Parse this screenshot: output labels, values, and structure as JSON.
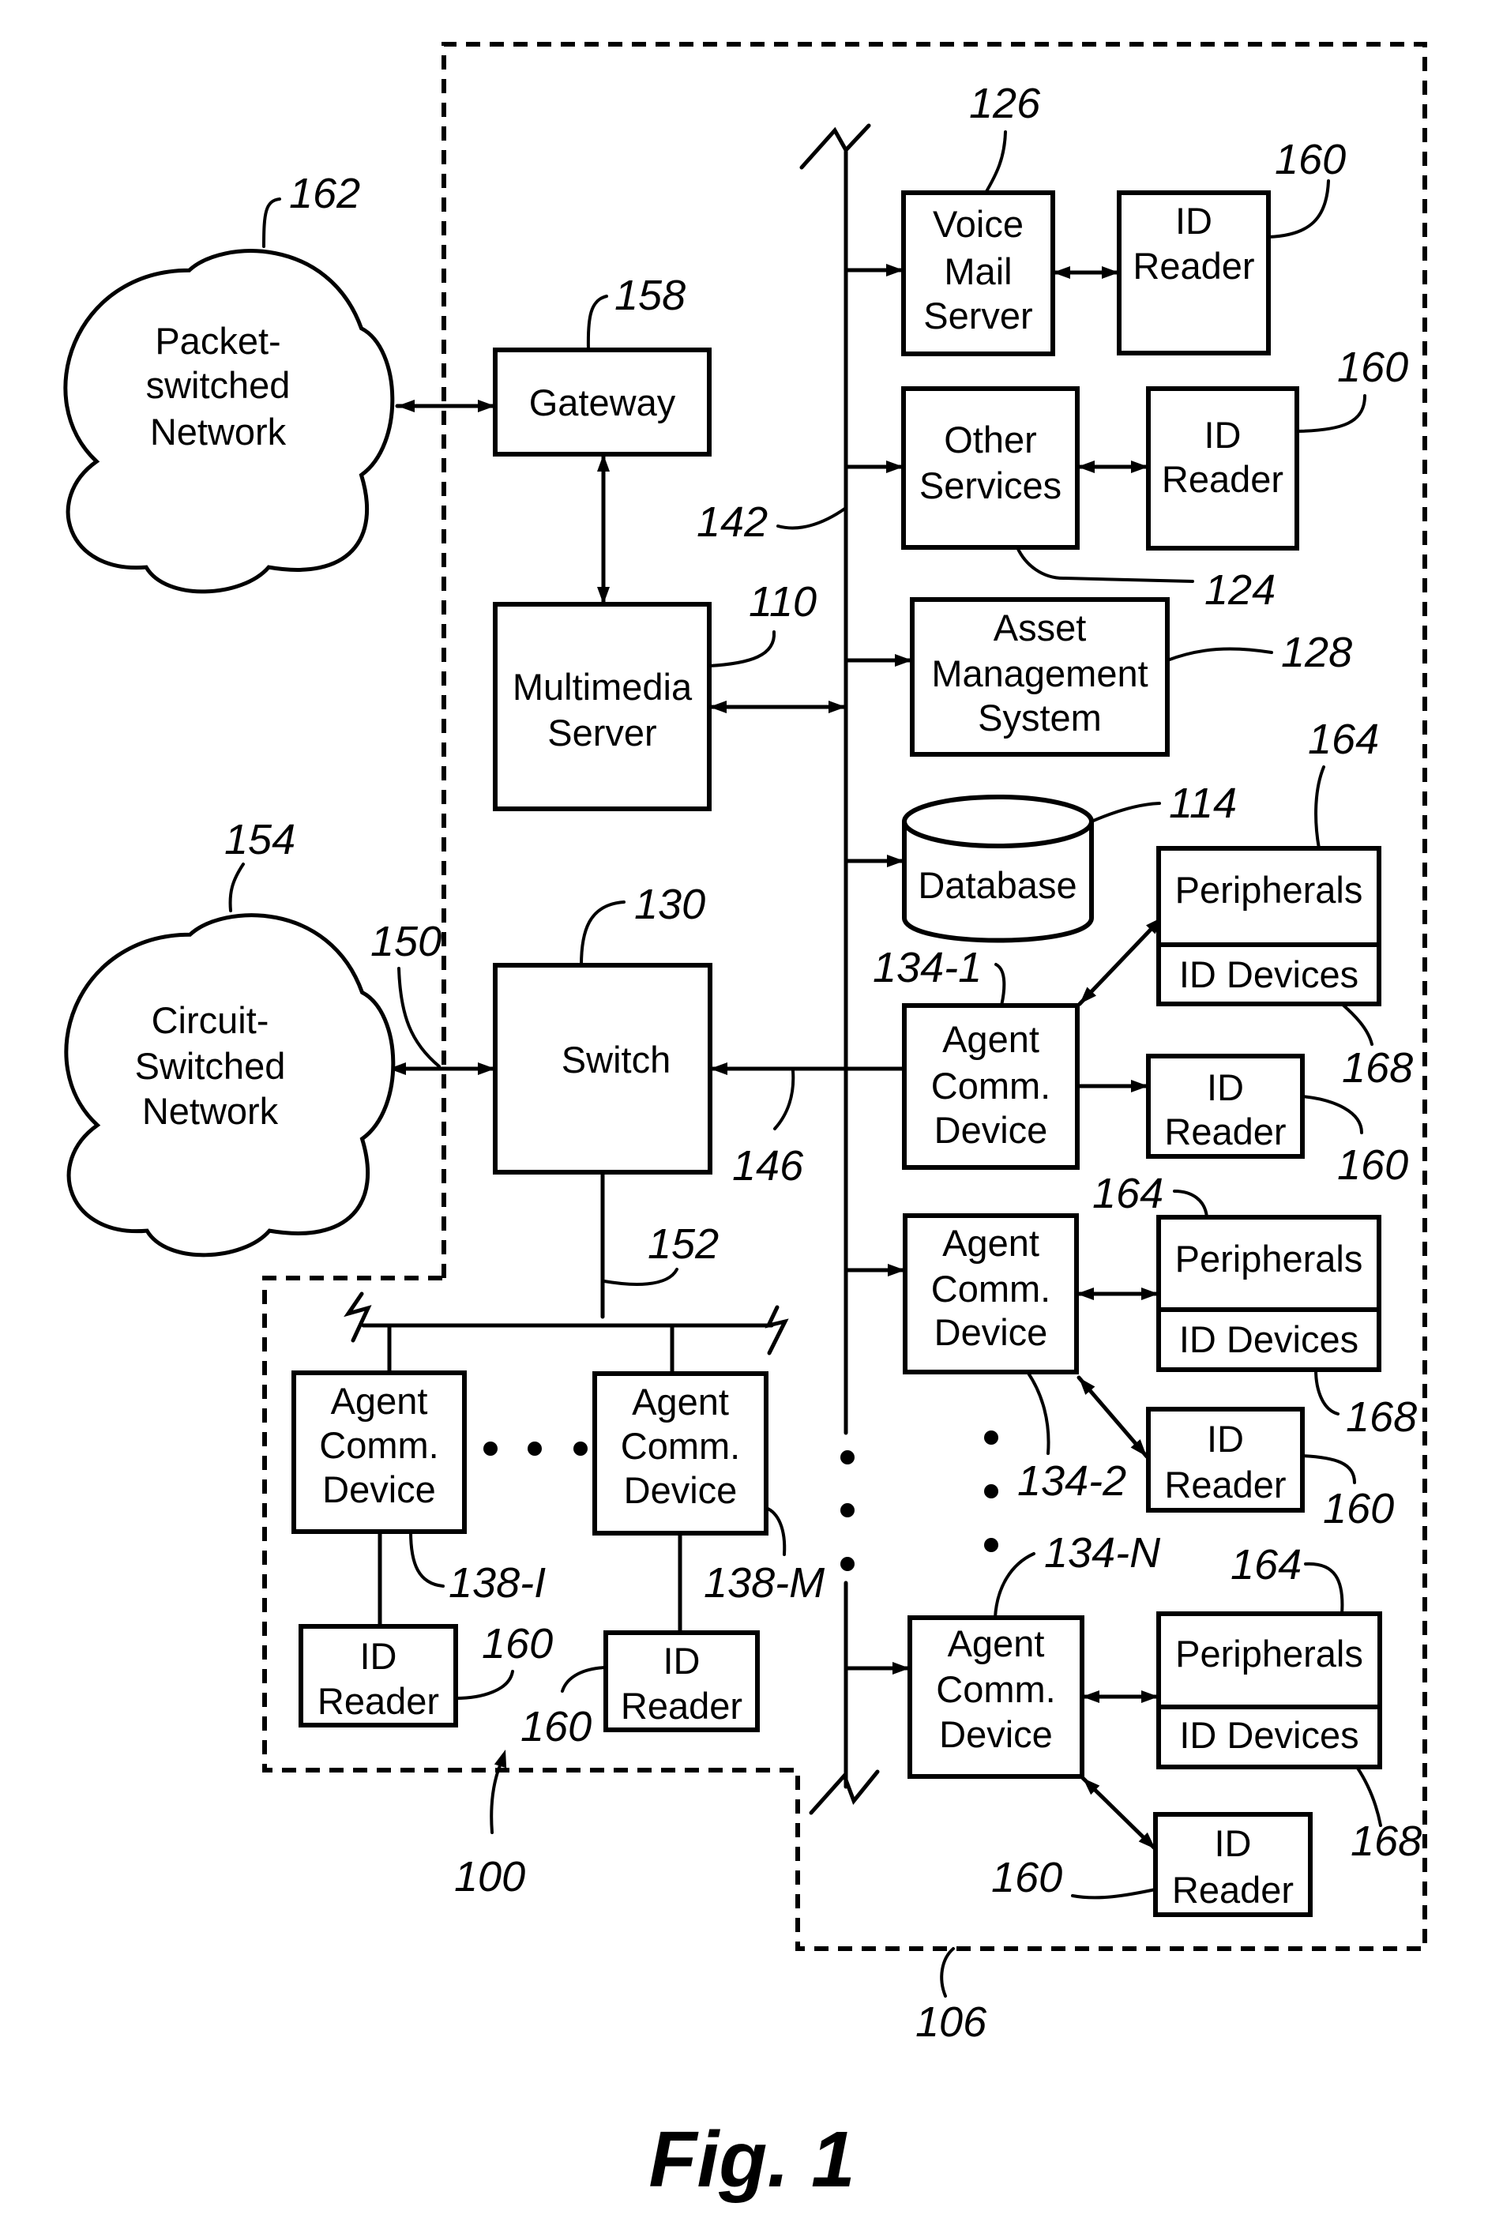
{
  "figure": {
    "caption": "Fig. 1",
    "colors": {
      "ink": "#000000",
      "paper": "#ffffff"
    }
  },
  "clouds": {
    "packet": {
      "ref": "162",
      "lines": [
        "Packet-",
        "switched",
        "Network"
      ]
    },
    "circuit": {
      "ref": "154",
      "lines": [
        "Circuit-",
        "Switched",
        "Network"
      ]
    }
  },
  "boxes": {
    "gateway": {
      "ref": "158",
      "lines": [
        "Gateway"
      ]
    },
    "multimedia_server": {
      "ref": "110",
      "lines": [
        "Multimedia",
        "Server"
      ]
    },
    "switch": {
      "ref": "130",
      "lines": [
        "Switch"
      ]
    },
    "voice_mail_server": {
      "ref": "126",
      "lines": [
        "Voice",
        "Mail",
        "Server"
      ]
    },
    "id_reader_voice_mail": {
      "ref": "160",
      "lines": [
        "ID",
        "Reader"
      ]
    },
    "other_services": {
      "ref": "124",
      "lines": [
        "Other",
        "Services"
      ]
    },
    "id_reader_other_services": {
      "ref": "160",
      "lines": [
        "ID",
        "Reader"
      ]
    },
    "asset_management": {
      "ref": "128",
      "lines": [
        "Asset",
        "Management",
        "System"
      ]
    },
    "database": {
      "ref": "114",
      "lines": [
        "Database"
      ]
    },
    "agent_134_1": {
      "ref": "134-1",
      "lines": [
        "Agent",
        "Comm.",
        "Device"
      ]
    },
    "peripherals_1": {
      "ref": "164",
      "lines": [
        "Peripherals"
      ]
    },
    "id_devices_1": {
      "ref": "168",
      "lines": [
        "ID Devices"
      ]
    },
    "id_reader_134_1": {
      "ref": "160",
      "lines": [
        "ID",
        "Reader"
      ]
    },
    "agent_134_2": {
      "ref": "134-2",
      "lines": [
        "Agent",
        "Comm.",
        "Device"
      ]
    },
    "peripherals_2": {
      "ref": "164",
      "lines": [
        "Peripherals"
      ]
    },
    "id_devices_2": {
      "ref": "168",
      "lines": [
        "ID Devices"
      ]
    },
    "id_reader_134_2": {
      "ref": "160",
      "lines": [
        "ID",
        "Reader"
      ]
    },
    "agent_134_n": {
      "ref": "134-N",
      "lines": [
        "Agent",
        "Comm.",
        "Device"
      ]
    },
    "peripherals_n": {
      "ref": "164",
      "lines": [
        "Peripherals"
      ]
    },
    "id_devices_n": {
      "ref": "168",
      "lines": [
        "ID Devices"
      ]
    },
    "id_reader_134_n": {
      "ref": "160",
      "lines": [
        "ID",
        "Reader"
      ]
    },
    "agent_138_i": {
      "ref": "138-I",
      "lines": [
        "Agent",
        "Comm.",
        "Device"
      ]
    },
    "id_reader_138_i": {
      "ref": "160",
      "lines": [
        "ID",
        "Reader"
      ]
    },
    "agent_138_m": {
      "ref": "138-M",
      "lines": [
        "Agent",
        "Comm.",
        "Device"
      ]
    },
    "id_reader_138_m": {
      "ref": "160",
      "lines": [
        "ID",
        "Reader"
      ]
    }
  },
  "refs": {
    "lan_bus": "142",
    "switch_to_lan_link": "146",
    "trunk_link": "150",
    "agent_bus": "152",
    "contact_center": "100",
    "enterprise_network": "106"
  }
}
